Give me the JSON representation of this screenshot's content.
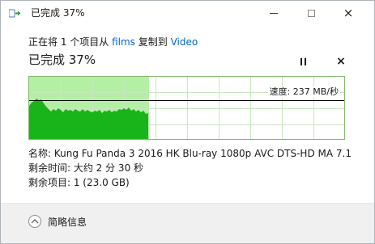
{
  "window": {
    "title": "已完成 37%",
    "controls": {
      "minimize": "minimize-icon",
      "maximize": "maximize-icon",
      "close": "×"
    }
  },
  "copy": {
    "prefix": "正在将 1 个项目从",
    "source": "films",
    "middle": "复制到",
    "destination": "Video"
  },
  "progress": {
    "heading": "已完成 37%",
    "percent": 37,
    "pause_icon": "pause-icon",
    "stop_label": "×"
  },
  "graph": {
    "speed_label": "速度: 237 MB/秒",
    "colors": {
      "done_fill": "#b4f0a4",
      "speed_fill": "#19b419",
      "grid": "#c8e6c0",
      "speed_line": "#000000"
    }
  },
  "details": {
    "name": "名称: Kung Fu Panda 3 2016 HK  Blu-ray 1080p AVC DTS-HD MA 7.1",
    "time_remaining": "剩余时间: 大约 2 分 30 秒",
    "items_remaining": "剩余项目: 1 (23.0 GB)"
  },
  "footer": {
    "toggle_label": "简略信息",
    "toggle_icon": "chevron-up-icon"
  }
}
